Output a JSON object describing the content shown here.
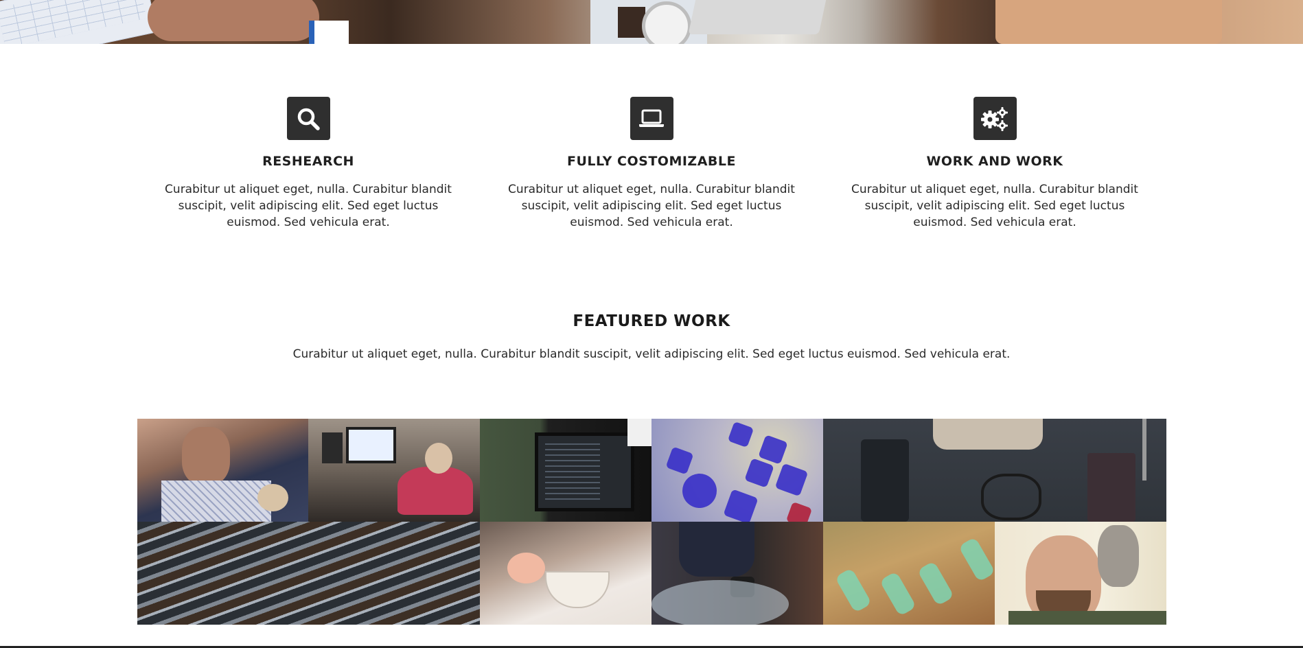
{
  "hero": {
    "image": "business-desk-photo"
  },
  "features": [
    {
      "icon": "search-icon",
      "title": "RESHEARCH",
      "text": "Curabitur ut aliquet eget, nulla. Curabitur blandit suscipit, velit adipiscing elit. Sed eget luctus euismod. Sed vehicula erat."
    },
    {
      "icon": "laptop-icon",
      "title": "FULLY COSTOMIZABLE",
      "text": "Curabitur ut aliquet eget, nulla. Curabitur blandit suscipit, velit adipiscing elit. Sed eget luctus euismod. Sed vehicula erat."
    },
    {
      "icon": "gears-icon",
      "title": "WORK AND WORK",
      "text": "Curabitur ut aliquet eget, nulla. Curabitur blandit suscipit, velit adipiscing elit. Sed eget luctus euismod. Sed vehicula erat."
    }
  ],
  "featured": {
    "title": "FEATURED WORK",
    "description": "Curabitur ut aliquet eget, nulla. Curabitur blandit suscipit, velit adipiscing elit. Sed eget luctus euismod. Sed vehicula erat."
  },
  "gallery": {
    "items": [
      "man-with-kitten-photo",
      "gamer-at-desk-photo",
      "person-at-monitor-photo",
      "blue-dice-photo",
      "desk-flatlay-photo",
      "water-texture-photo",
      "teacup-photo",
      "smoke-worker-photo",
      "green-bottles-photo",
      "man-with-cat-photo"
    ]
  },
  "colors": {
    "icon_box": "#2f2f2f",
    "text": "#222222",
    "background": "#ffffff"
  }
}
